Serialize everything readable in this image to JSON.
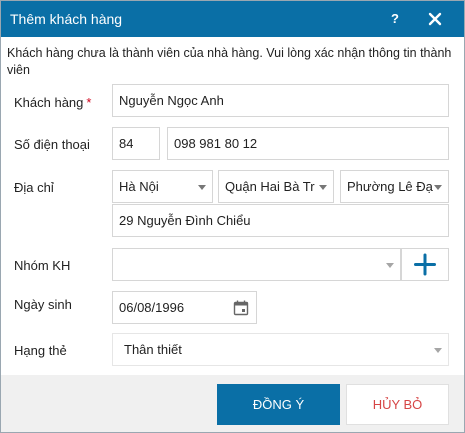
{
  "dialog": {
    "title": "Thêm khách hàng",
    "help_label": "?",
    "notice": "Khách hàng chưa là thành viên của nhà hàng.  Vui lòng xác nhận thông tin thành viên"
  },
  "form": {
    "customer": {
      "label": "Khách hàng",
      "required_mark": "*",
      "value": "Nguyễn Ngọc Anh"
    },
    "phone": {
      "label": "Số điện thoại",
      "country_code": "84",
      "number": "098 981 80 12"
    },
    "address": {
      "label": "Địa chỉ",
      "province": "Hà Nội",
      "district": "Quận Hai Bà Tr",
      "ward": "Phường Lê Đạ",
      "street": "29 Nguyễn Đình Chiểu"
    },
    "group": {
      "label": "Nhóm KH",
      "value": ""
    },
    "birthday": {
      "label": "Ngày sinh",
      "value": "06/08/1996"
    },
    "card_tier": {
      "label": "Hạng thẻ",
      "value": "Thân thiết"
    }
  },
  "buttons": {
    "ok": "ĐỒNG Ý",
    "cancel": "HỦY BỎ"
  },
  "icons": {
    "close": "close-icon",
    "add": "plus-icon",
    "calendar": "calendar-icon",
    "dropdown": "chevron-down-icon"
  },
  "colors": {
    "primary": "#0a6fa6",
    "cancel_text": "#d64545",
    "required": "#d0021b"
  }
}
